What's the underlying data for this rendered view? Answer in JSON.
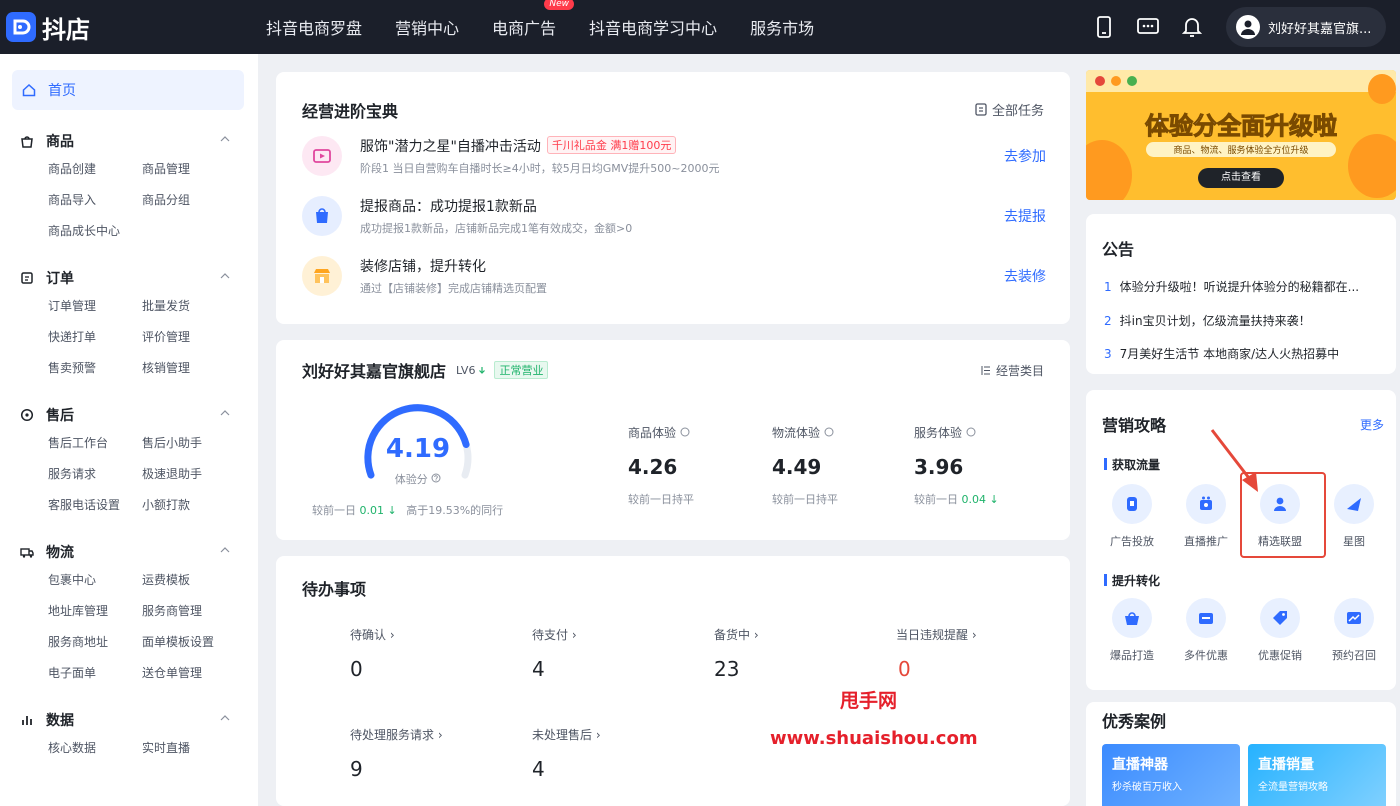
{
  "app": {
    "name": "抖店"
  },
  "topnav": {
    "items": [
      {
        "label": "抖音电商罗盘"
      },
      {
        "label": "营销中心"
      },
      {
        "label": "电商广告",
        "badge": "New"
      },
      {
        "label": "抖音电商学习中心"
      },
      {
        "label": "服务市场"
      }
    ],
    "user_name": "刘好好其嘉官旗..."
  },
  "sidebar": {
    "home": "首页",
    "groups": [
      {
        "title": "商品",
        "items": [
          "商品创建",
          "商品管理",
          "商品导入",
          "商品分组",
          "商品成长中心"
        ]
      },
      {
        "title": "订单",
        "items": [
          "订单管理",
          "批量发货",
          "快递打单",
          "评价管理",
          "售卖预警",
          "核销管理"
        ]
      },
      {
        "title": "售后",
        "items": [
          "售后工作台",
          "售后小助手",
          "服务请求",
          "极速退助手",
          "客服电话设置",
          "小额打款"
        ]
      },
      {
        "title": "物流",
        "items": [
          "包裹中心",
          "运费模板",
          "地址库管理",
          "服务商管理",
          "服务商地址",
          "面单模板设置",
          "电子面单",
          "送仓单管理"
        ]
      },
      {
        "title": "数据",
        "items": [
          "核心数据",
          "实时直播"
        ]
      }
    ]
  },
  "guide": {
    "title": "经营进阶宝典",
    "all_tasks": "全部任务",
    "tasks": [
      {
        "title": "服饰\"潜力之星\"自播冲击活动",
        "tag": "千川礼品金  满1赠100元",
        "desc": "阶段1 当日自营购车自播时长≥4小时，较5月日均GMV提升500~2000元",
        "action": "去参加"
      },
      {
        "title": "提报商品：成功提报1款新品",
        "tag": "",
        "desc": "成功提报1款新品，店铺新品完成1笔有效成交，金额>0",
        "action": "去提报"
      },
      {
        "title": "装修店铺，提升转化",
        "tag": "",
        "desc": "通过【店铺装修】完成店铺精选页配置",
        "action": "去装修"
      }
    ]
  },
  "store": {
    "name": "刘好好其嘉官旗舰店",
    "level": "LV6",
    "status": "正常营业",
    "category_link": "经营类目",
    "score": "4.19",
    "score_label": "体验分",
    "score_fraction": 0.838,
    "compare_prefix": "较前一日",
    "compare_value": "0.01",
    "compare_arrow": "↓",
    "rank_text": "高于19.53%的同行",
    "metrics": [
      {
        "label": "商品体验",
        "value": "4.26",
        "sub": "较前一日持平",
        "delta": "",
        "arrow": ""
      },
      {
        "label": "物流体验",
        "value": "4.49",
        "sub": "较前一日持平",
        "delta": "",
        "arrow": ""
      },
      {
        "label": "服务体验",
        "value": "3.96",
        "sub": "较前一日",
        "delta": "0.04",
        "arrow": "↓"
      }
    ]
  },
  "todo": {
    "title": "待办事项",
    "items": [
      {
        "label": "待确认",
        "value": "0"
      },
      {
        "label": "待支付",
        "value": "4"
      },
      {
        "label": "备货中",
        "value": "23"
      },
      {
        "label": "当日违规提醒",
        "value": "0"
      },
      {
        "label": "待处理服务请求",
        "value": "9"
      },
      {
        "label": "未处理售后",
        "value": "4"
      }
    ]
  },
  "watermark": {
    "cn": "甩手网",
    "url": "www.shuaishou.com"
  },
  "banner": {
    "headline": "体验分全面升级啦",
    "sub": "商品、物流、服务体验全方位升级",
    "cta": "点击查看"
  },
  "notice": {
    "title": "公告",
    "items": [
      {
        "num": "1",
        "text": "体验分升级啦！听说提升体验分的秘籍都在..."
      },
      {
        "num": "2",
        "text": "抖in宝贝计划，亿级流量扶持来袭！"
      },
      {
        "num": "3",
        "text": "7月美好生活节 本地商家/达人火热招募中"
      }
    ]
  },
  "marketing": {
    "title": "营销攻略",
    "more": "更多",
    "section1": "获取流量",
    "section2": "提升转化",
    "tools1": [
      "广告投放",
      "直播推广",
      "精选联盟",
      "星图"
    ],
    "tools2": [
      "爆品打造",
      "多件优惠",
      "优惠促销",
      "预约召回"
    ]
  },
  "cases": {
    "title": "优秀案例",
    "c1_title": "直播神器",
    "c1_sub": "秒杀破百万收入",
    "c2_title": "直播销量",
    "c2_sub": "全流量营销攻略"
  },
  "colors": {
    "accent": "#2f6bff",
    "topbar": "#1b1f2a",
    "highlight": "#e5483a"
  }
}
